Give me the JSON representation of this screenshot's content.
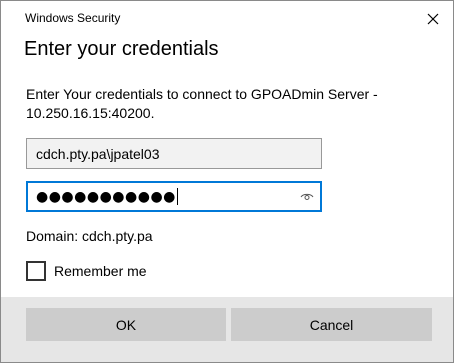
{
  "window": {
    "title": "Windows Security"
  },
  "heading": "Enter your credentials",
  "message": "Enter Your credentials to connect to GPOADmin Server - 10.250.16.15:40200.",
  "username": {
    "value": "cdch.pty.pa\\jpatel03"
  },
  "password": {
    "masked_value": "●●●●●●●●●●●",
    "reveal_icon": "eye-icon"
  },
  "domain_text": "Domain: cdch.pty.pa",
  "remember": {
    "label": "Remember me",
    "checked": false
  },
  "buttons": {
    "ok": "OK",
    "cancel": "Cancel"
  },
  "colors": {
    "focus_border": "#0078d7",
    "button_bg": "#cccccc",
    "footer_bg": "#e6e6e6"
  }
}
